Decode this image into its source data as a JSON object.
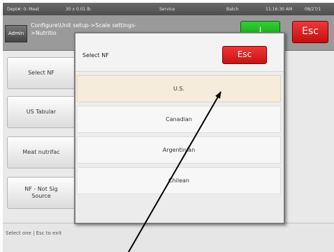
{
  "topbar": {
    "dept": "Dept#: 0: Meat",
    "weight": "30 x 0.01 lb",
    "mode": "Service",
    "batch": "Batch",
    "time": "11:16:30 AM",
    "date": "08/27/1"
  },
  "header": {
    "admin_label": "Admin",
    "breadcrumb_line1": "Configure\\Unit setup->Scale settings-",
    "breadcrumb_line2": ">Nutritio",
    "ok_label": "↓",
    "esc_label": "Esc"
  },
  "sidebar": {
    "items": [
      {
        "label": "Select NF"
      },
      {
        "label": "US Tabular"
      },
      {
        "label": "Meat nutrifac"
      },
      {
        "label_line1": "NF - Not Sig",
        "label_line2": "Source"
      }
    ]
  },
  "status": {
    "text": "Select one | Esc to exit"
  },
  "dialog": {
    "title": "Select NF",
    "esc_label": "Esc",
    "options": [
      {
        "label": "U.S."
      },
      {
        "label": "Canadian"
      },
      {
        "label": "Argentinian"
      },
      {
        "label": "Chilean"
      }
    ],
    "selected": "U.S."
  },
  "annotation": {
    "arrow_color": "#000000"
  }
}
